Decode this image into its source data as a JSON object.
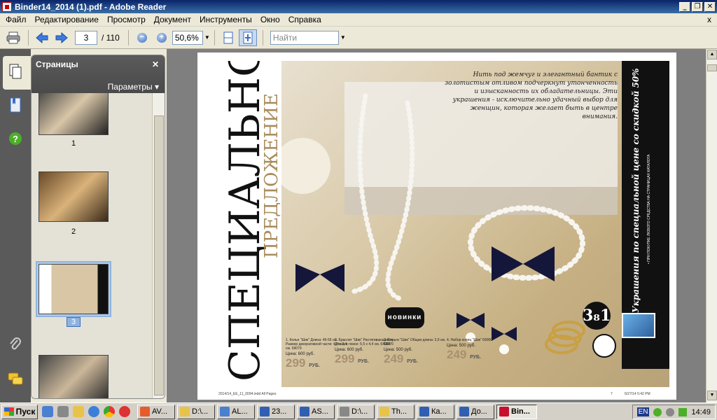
{
  "window": {
    "title": "Binder14_2014 (1).pdf - Adobe Reader",
    "min": "_",
    "max": "❐",
    "close": "✕"
  },
  "menu": {
    "items": [
      "Файл",
      "Редактирование",
      "Просмотр",
      "Документ",
      "Инструменты",
      "Окно",
      "Справка"
    ],
    "close_doc": "x"
  },
  "toolbar": {
    "page_current": "3",
    "page_total": "/ 110",
    "zoom": "50,6%",
    "find_placeholder": "Найти"
  },
  "pages_panel": {
    "title": "Страницы",
    "close": "✕",
    "options": "Параметры ▾",
    "thumbs": [
      {
        "label": "1"
      },
      {
        "label": "2"
      },
      {
        "label": "3"
      }
    ]
  },
  "document": {
    "vertical_title_main": "СПЕЦИАЛЬНОЕ",
    "vertical_title_sub": "ПРЕДЛОЖЕНИЕ",
    "quote": "Нить под жемчуг и элегантный бантик с золотистым отливом подчеркнут утонченность и изысканность их обладательницы. Эти украшения - исключительно удачный выбор для женщин, которая желает быть в центре внимания.",
    "sidebar_heading": "Украшения по специальной цене со скидкой 50%",
    "sidebar_small": "• ПРИ ПОКУПКЕ ЛЮБОГО СРЕДСТВА НА СТРАНИЦАХ КАТАЛОГА",
    "badge_new": "новинки",
    "big_offer": "3₈1",
    "products": [
      {
        "meta": "1. Колье \"Шик\" Длина: 49-56 см. Размер декоративной части: 4,8 x 2,4 см. 69079",
        "price_label": "Цена: 600 руб.",
        "price": "299",
        "cur": "РУБ."
      },
      {
        "meta": "2. Браслет \"Шик\" Растягивающийся. Длина в покое: 5,5 x 4,4 см. 64904",
        "price_label": "Цена: 600 руб.",
        "price": "299",
        "cur": "РУБ."
      },
      {
        "meta": "3. Серьги \"Шик\" Общая длина: 3,9 см. 69070",
        "price_label": "Цена: 500 руб.",
        "price": "249",
        "cur": "РУБ."
      },
      {
        "meta": "4. Набор колец \"Шик\" 69000",
        "price_label": "Цена: 500 руб.",
        "price": "249",
        "cur": "РУБ."
      }
    ],
    "footer_left": "2014/14_EE_11_0094.indd  All Pages",
    "footer_page": "7",
    "footer_right": "6/27/14  5:42 PM"
  },
  "taskbar": {
    "start": "Пуск",
    "tasks": [
      {
        "label": "AV...",
        "color": "#e65c2c"
      },
      {
        "label": "D:\\...",
        "color": "#e8c34a"
      },
      {
        "label": "AL...",
        "color": "#4b7fd0"
      },
      {
        "label": "23...",
        "color": "#2f5fb3"
      },
      {
        "label": "AS...",
        "color": "#2f5fb3"
      },
      {
        "label": "D:\\...",
        "color": "#888888"
      },
      {
        "label": "Th...",
        "color": "#e8c34a"
      },
      {
        "label": "Ка...",
        "color": "#2f5fb3"
      },
      {
        "label": "До...",
        "color": "#2f5fb3"
      },
      {
        "label": "Bin...",
        "color": "#c8102e"
      }
    ],
    "lang": "EN",
    "clock": "14:49"
  }
}
